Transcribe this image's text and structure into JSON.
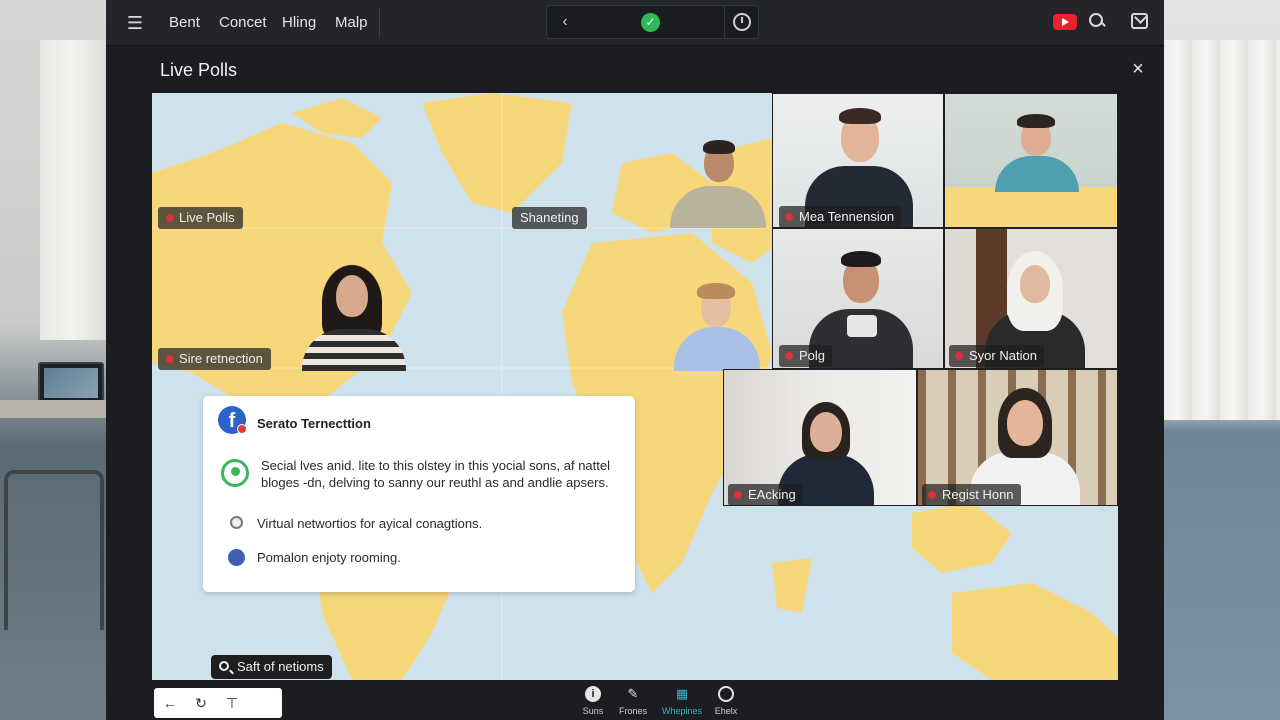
{
  "topbar": {
    "nav": [
      "Bent",
      "Concet",
      "Hling",
      "Malp"
    ],
    "icons": [
      "menu-icon",
      "back-arrow-icon",
      "check-icon",
      "clock-icon",
      "youtube-icon",
      "search-icon",
      "share-icon"
    ]
  },
  "panel": {
    "title": "Live Polls",
    "close_icon": "×"
  },
  "map_labels": {
    "live_polls": "Live Polls",
    "sharing": "Shaneting",
    "site_reconnection": "Sire retnection"
  },
  "participants": [
    {
      "name": "Mea Tennension"
    },
    {
      "name": "Polg"
    },
    {
      "name": "Syor Nation"
    },
    {
      "name": "EAcking"
    },
    {
      "name": "Regist Honn"
    }
  ],
  "poll": {
    "title": "Serato Ternecttion",
    "option1": "Secial lves anid. lite to this olstey in this yocial sons, af nattel bloges -dn, delving to sanny our reuthl as and andlie apsers.",
    "option2": "Virtual networtios for ayical conagtions.",
    "option3": "Pomalon enjoty rooming."
  },
  "search_pill": "Saft of netioms",
  "toolbar": {
    "mini": [
      "←",
      "↻",
      "⊤"
    ],
    "tools": [
      {
        "label": "Suns",
        "icon": "info-icon"
      },
      {
        "label": "Frones",
        "icon": "pin-icon"
      },
      {
        "label": "Whepines",
        "icon": "grid-icon"
      },
      {
        "label": "Ehelx",
        "icon": "record-icon"
      }
    ]
  },
  "colors": {
    "map_ocean": "#cfe2ec",
    "map_land": "#f6d77a",
    "record_dot": "#d8333a",
    "check_green": "#2dbb55",
    "active_tool": "#39b3c8"
  }
}
